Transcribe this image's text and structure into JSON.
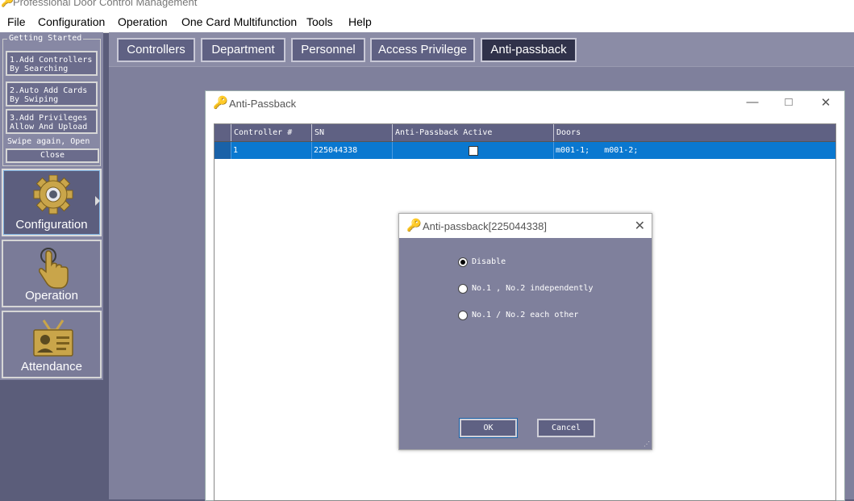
{
  "app": {
    "title": "Professional Door Control Management"
  },
  "menu": [
    "File",
    "Configuration",
    "Operation",
    "One Card Multifunction",
    "Tools",
    "Help"
  ],
  "getting_started": {
    "title": "Getting Started",
    "step1": "1.Add Controllers\nBy Searching",
    "step2": "2.Auto Add Cards\nBy Swiping",
    "step3": "3.Add Privileges\nAllow And Upload",
    "swipe": "Swipe again, Open",
    "close": "Close"
  },
  "sidebar": {
    "configuration": "Configuration",
    "operation": "Operation",
    "attendance": "Attendance"
  },
  "tabs": [
    "Controllers",
    "Department",
    "Personnel",
    "Access Privilege",
    "Anti-passback"
  ],
  "window": {
    "title": "Anti-Passback",
    "columns": [
      "Controller #",
      "SN",
      "Anti-Passback Active",
      "Doors"
    ],
    "row": {
      "controller": "1",
      "sn": "225044338",
      "active": false,
      "doors": "m001-1;   m001-2;"
    }
  },
  "dialog": {
    "title": "Anti-passback[225044338]",
    "options": [
      "Disable",
      "No.1 , No.2 independently",
      "No.1 / No.2 each other"
    ],
    "selected": 0,
    "ok": "OK",
    "cancel": "Cancel"
  }
}
